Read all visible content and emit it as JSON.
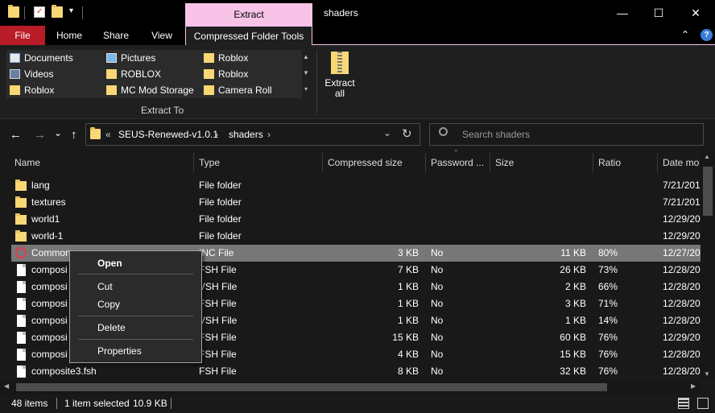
{
  "window": {
    "title": "shaders",
    "contextual_tab": "Extract",
    "minimize_glyph": "—",
    "maximize_glyph": "☐",
    "close_glyph": "✕"
  },
  "ribbon_tabs": {
    "file": "File",
    "home": "Home",
    "share": "Share",
    "view": "View",
    "compressed_folder_tools": "Compressed Folder Tools",
    "help_glyph": "?",
    "collapse_glyph": "⌃"
  },
  "ribbon": {
    "extract_to_items": [
      {
        "label": "Documents",
        "icon": "documents-icon"
      },
      {
        "label": "Pictures",
        "icon": "pictures-icon"
      },
      {
        "label": "Roblox",
        "icon": "folder-icon"
      },
      {
        "label": "Videos",
        "icon": "videos-icon"
      },
      {
        "label": "ROBLOX",
        "icon": "folder-icon"
      },
      {
        "label": "Roblox",
        "icon": "folder-icon"
      },
      {
        "label": "Roblox",
        "icon": "folder-icon"
      },
      {
        "label": "MC Mod Storage",
        "icon": "folder-icon"
      },
      {
        "label": "Camera Roll",
        "icon": "folder-icon"
      }
    ],
    "extract_to_group_label": "Extract To",
    "extract_all_line1": "Extract",
    "extract_all_line2": "all"
  },
  "address": {
    "overflow": "«",
    "crumb1": "SEUS-Renewed-v1.0.1",
    "sep": "›",
    "crumb2": "shaders",
    "search_placeholder": "Search shaders"
  },
  "nav": {
    "back": "←",
    "forward": "→",
    "recent": "⌄",
    "up": "↑",
    "refresh": "↻",
    "dropdown": "⌄"
  },
  "columns": {
    "name": "Name",
    "type": "Type",
    "compressed_size": "Compressed size",
    "password": "Password ...",
    "size": "Size",
    "ratio": "Ratio",
    "date": "Date mo"
  },
  "files": [
    {
      "name": "lang",
      "type": "File folder",
      "csize": "",
      "password": "",
      "size": "",
      "ratio": "",
      "date": "7/21/201",
      "icon": "folder"
    },
    {
      "name": "textures",
      "type": "File folder",
      "csize": "",
      "password": "",
      "size": "",
      "ratio": "",
      "date": "7/21/201",
      "icon": "folder"
    },
    {
      "name": "world1",
      "type": "File folder",
      "csize": "",
      "password": "",
      "size": "",
      "ratio": "",
      "date": "12/29/20",
      "icon": "folder"
    },
    {
      "name": "world-1",
      "type": "File folder",
      "csize": "",
      "password": "",
      "size": "",
      "ratio": "",
      "date": "12/29/20",
      "icon": "folder"
    },
    {
      "name": "Common",
      "type": "INC File",
      "csize": "3 KB",
      "password": "No",
      "size": "11 KB",
      "ratio": "80%",
      "date": "12/27/20",
      "icon": "blocked"
    },
    {
      "name": "composi",
      "type": "FSH File",
      "csize": "7 KB",
      "password": "No",
      "size": "26 KB",
      "ratio": "73%",
      "date": "12/28/20",
      "icon": "doc"
    },
    {
      "name": "composi",
      "type": "VSH File",
      "csize": "1 KB",
      "password": "No",
      "size": "2 KB",
      "ratio": "66%",
      "date": "12/28/20",
      "icon": "doc"
    },
    {
      "name": "composi",
      "type": "FSH File",
      "csize": "1 KB",
      "password": "No",
      "size": "3 KB",
      "ratio": "71%",
      "date": "12/28/20",
      "icon": "doc"
    },
    {
      "name": "composi",
      "type": "VSH File",
      "csize": "1 KB",
      "password": "No",
      "size": "1 KB",
      "ratio": "14%",
      "date": "12/28/20",
      "icon": "doc"
    },
    {
      "name": "composi",
      "type": "FSH File",
      "csize": "15 KB",
      "password": "No",
      "size": "60 KB",
      "ratio": "76%",
      "date": "12/29/20",
      "icon": "doc"
    },
    {
      "name": "composi",
      "type": "FSH File",
      "csize": "4 KB",
      "password": "No",
      "size": "15 KB",
      "ratio": "76%",
      "date": "12/28/20",
      "icon": "doc"
    },
    {
      "name": "composite3.fsh",
      "type": "FSH File",
      "csize": "8 KB",
      "password": "No",
      "size": "32 KB",
      "ratio": "76%",
      "date": "12/28/20",
      "icon": "doc"
    }
  ],
  "context_menu": {
    "open": "Open",
    "cut": "Cut",
    "copy": "Copy",
    "delete": "Delete",
    "properties": "Properties"
  },
  "status": {
    "items": "48 items",
    "selected": "1 item selected",
    "selected_size": "10.9 KB"
  }
}
